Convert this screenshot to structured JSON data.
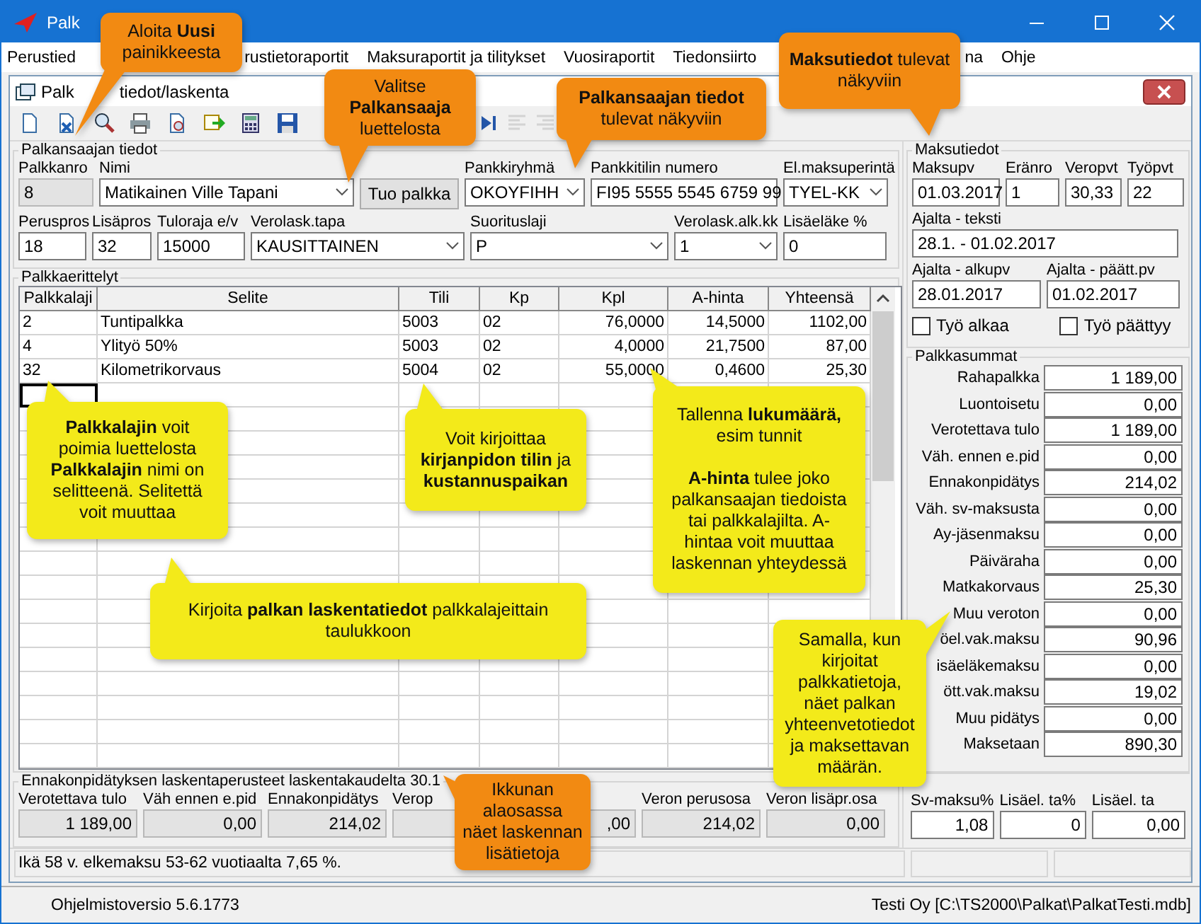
{
  "window": {
    "title": "Palk"
  },
  "menu": [
    {
      "label": "Perustied"
    },
    {
      "label": "rustietoraportit"
    },
    {
      "label": "Maksuraportit ja tilitykset"
    },
    {
      "label": "Vuosiraportit"
    },
    {
      "label": "Tiedonsiirto"
    },
    {
      "label": "na"
    },
    {
      "label": "Ohje"
    }
  ],
  "child_window": {
    "title_parts": [
      "Palk",
      "tiedot/laskenta"
    ]
  },
  "toolbar": [
    {
      "disabled": false
    },
    {
      "disabled": false
    },
    {
      "disabled": false
    },
    {
      "disabled": false
    },
    {
      "disabled": false
    },
    {
      "disabled": false
    },
    {
      "disabled": false
    },
    {
      "disabled": false
    },
    {
      "disabled": false
    },
    {
      "disabled": true
    },
    {
      "disabled": true
    }
  ],
  "payee": {
    "title": "Palkansaajan tiedot",
    "top_fields": [
      {
        "kind": "readonly",
        "label": "Palkkanro",
        "value": "8"
      },
      {
        "kind": "dropdown",
        "label": "Nimi",
        "value": "Matikainen Ville Tapani"
      },
      {
        "kind": "button",
        "text": "Tuo palkka"
      },
      {
        "kind": "dropdown",
        "label": "Pankkiryhmä",
        "value": "OKOYFIHH"
      },
      {
        "kind": "text",
        "label": "Pankkitilin numero",
        "value": "FI95 5555 5545 6759 99"
      },
      {
        "kind": "dropdown",
        "label": "El.maksuperintä",
        "value": "TYEL-KK"
      }
    ],
    "bottom_fields": [
      {
        "kind": "text",
        "label": "Peruspros",
        "value": "18"
      },
      {
        "kind": "text",
        "label": "Lisäpros",
        "value": "32"
      },
      {
        "kind": "text",
        "label": "Tuloraja e/v",
        "value": "15000"
      },
      {
        "kind": "dropdown",
        "label": "Verolask.tapa",
        "value": "KAUSITTAINEN"
      },
      {
        "kind": "dropdown",
        "label": "Suorituslaji",
        "value": "P"
      },
      {
        "kind": "dropdown",
        "label": "Verolask.alk.kk",
        "value": "1"
      },
      {
        "kind": "text",
        "label": "Lisäeläke %",
        "value": "0"
      }
    ]
  },
  "lines": {
    "title": "Palkkaerittelyt",
    "columns": [
      "Palkkalaji",
      "Selite",
      "Tili",
      "Kp",
      "Kpl",
      "A-hinta",
      "Yhteensä"
    ],
    "rows": [
      {
        "cells": [
          "2",
          "Tuntipalkka",
          "5003",
          "02",
          "76,0000",
          "14,5000",
          "1102,00"
        ]
      },
      {
        "cells": [
          "4",
          "Ylityö 50%",
          "5003",
          "02",
          "4,0000",
          "21,7500",
          "87,00"
        ]
      },
      {
        "cells": [
          "32",
          "Kilometrikorvaus",
          "5004",
          "02",
          "55,0000",
          "0,4600",
          "25,30"
        ]
      }
    ],
    "new_row": {
      "selected": true
    }
  },
  "tax_basis": {
    "title": "Ennakonpidätyksen laskentaperusteet laskentakaudelta 30.1",
    "fields": [
      {
        "label": "Verotettava tulo",
        "value": "1 189,00"
      },
      {
        "label": "Väh ennen e.pid",
        "value": "0,00"
      },
      {
        "label": "Ennakonpidätys",
        "value": "214,02"
      },
      {
        "label": "Verop"
      },
      {
        "value": ",00"
      },
      {
        "label": "Veron perusosa",
        "value": "214,02"
      },
      {
        "label": "Veron lisäpr.osa",
        "value": "0,00"
      }
    ]
  },
  "payment": {
    "title": "Maksutiedot",
    "rows": [
      [
        {
          "label": "Maksupv",
          "value": "01.03.2017"
        },
        {
          "label": "Eränro",
          "value": "1"
        },
        {
          "label": "Veropvt",
          "value": "30,33"
        },
        {
          "label": "Työpvt",
          "value": "22"
        }
      ],
      [
        {
          "label": "Ajalta - teksti",
          "value": "28.1. - 01.02.2017"
        }
      ],
      [
        {
          "label": "Ajalta - alkupv",
          "value": "28.01.2017"
        },
        {
          "label": "Ajalta - päätt.pv",
          "value": "01.02.2017"
        }
      ]
    ],
    "checkboxes": [
      {
        "label": "Työ alkaa",
        "checked": false
      },
      {
        "label": "Työ päättyy",
        "checked": false
      }
    ]
  },
  "totals": {
    "title": "Palkkasummat",
    "rows": [
      {
        "label": "Rahapalkka",
        "value": "1 189,00"
      },
      {
        "label": "Luontoisetu",
        "value": "0,00"
      },
      {
        "label": "Verotettava tulo",
        "value": "1 189,00"
      },
      {
        "label": "Väh. ennen e.pid",
        "value": "0,00"
      },
      {
        "label": "Ennakonpidätys",
        "value": "214,02"
      },
      {
        "label": "Väh. sv-maksusta",
        "value": "0,00"
      },
      {
        "label": "Ay-jäsenmaksu",
        "value": "0,00"
      },
      {
        "label": "Päiväraha",
        "value": "0,00"
      },
      {
        "label": "Matkakorvaus",
        "value": "25,30"
      },
      {
        "label": "Muu veroton",
        "value": "0,00"
      },
      {
        "label": "öel.vak.maksu",
        "value": "90,96"
      },
      {
        "label": "isäeläkemaksu",
        "value": "0,00"
      },
      {
        "label": "ött.vak.maksu",
        "value": "19,02"
      },
      {
        "label": "Muu pidätys",
        "value": "0,00"
      },
      {
        "label": "Maksetaan",
        "value": "890,30"
      }
    ]
  },
  "pension": {
    "fields": [
      {
        "label": "Sv-maksu%",
        "value": "1,08"
      },
      {
        "label": "Lisäel. ta%",
        "value": "0"
      },
      {
        "label": "Lisäel. ta",
        "value": "0,00"
      }
    ]
  },
  "status_line": "Ikä 58 v. elkemaksu 53-62 vuotiaalta 7,65 %.",
  "status_bar": {
    "version": "Ohjelmistoversio 5.6.1773",
    "database": "Testi Oy [C:\\TS2000\\Palkat\\PalkatTesti.mdb]"
  },
  "callouts": [
    {
      "kind": "orange",
      "text": "Aloita **Uusi**\npainikkeesta"
    },
    {
      "kind": "orange",
      "text": "Valitse\n**Palkansaaja**\nluettelosta"
    },
    {
      "kind": "orange",
      "text": "**Palkansaajan tiedot**\ntulevat näkyviin"
    },
    {
      "kind": "orange",
      "text": "**Maksutiedot** tulevat\nnäkyviin"
    },
    {
      "kind": "yellow",
      "text": "**Palkkalajin** voit\npoimia luettelosta\n**Palkkalajin** nimi on\nselitteenä. Selitettä\nvoit muuttaa"
    },
    {
      "kind": "yellow",
      "text": "Voit kirjoittaa\n**kirjanpidon tilin** ja\n**kustannuspaikan**"
    },
    {
      "kind": "yellow",
      "text": "Tallenna **lukumäärä,**\nesim tunnit\n\n**A-hinta** tulee joko\npalkansaajan tiedoista\ntai palkkalajilta. A-\nhintaa voit muuttaa\nlaskennan yhteydessä"
    },
    {
      "kind": "yellow",
      "text": "Kirjoita **palkan laskentatiedot** palkkalajeittain\ntaulukkoon"
    },
    {
      "kind": "yellow",
      "text": "Samalla, kun\nkirjoitat\npalkkatietoja,\nnäet palkan\nyhteenvetotiedot\nja maksettavan\nmäärän."
    },
    {
      "kind": "orange",
      "text": "Ikkunan alaosassa\nnäet laskennan\nlisätietoja"
    }
  ]
}
